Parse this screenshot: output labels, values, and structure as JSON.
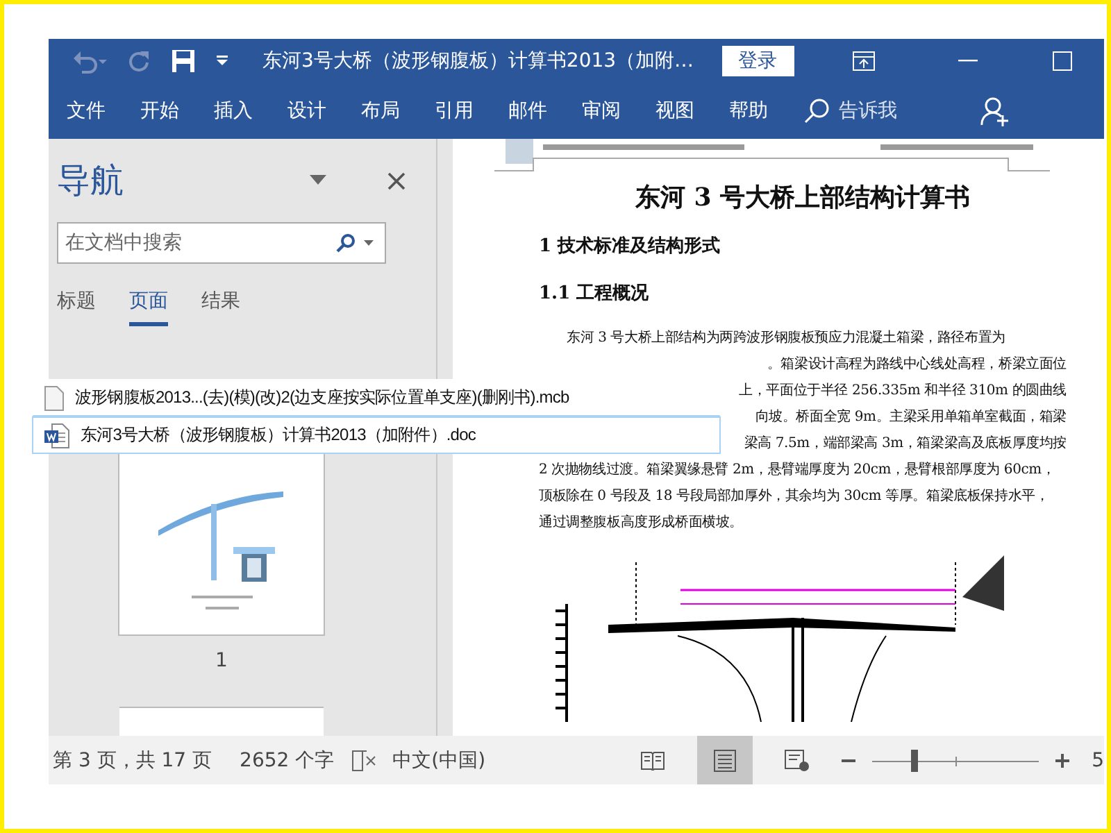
{
  "window": {
    "title": "东河3号大桥（波形钢腹板）计算书2013（加附…",
    "login": "登录"
  },
  "ribbon": {
    "tabs": [
      {
        "label": "文件"
      },
      {
        "label": "开始"
      },
      {
        "label": "插入"
      },
      {
        "label": "设计"
      },
      {
        "label": "布局"
      },
      {
        "label": "引用"
      },
      {
        "label": "邮件"
      },
      {
        "label": "审阅"
      },
      {
        "label": "视图"
      },
      {
        "label": "帮助"
      }
    ],
    "tell_me": "告诉我"
  },
  "navigation": {
    "title": "导航",
    "search": {
      "placeholder": "在文档中搜索"
    },
    "tabs": [
      {
        "label": "标题",
        "selected": false
      },
      {
        "label": "页面",
        "selected": true
      },
      {
        "label": "结果",
        "selected": false
      }
    ],
    "thumbnails": [
      {
        "label": "1"
      }
    ]
  },
  "document": {
    "blocks": [
      {
        "kind": "title",
        "text": "东河 3 号大桥上部结构计算书"
      },
      {
        "kind": "heading",
        "text": "1  技术标准及结构形式"
      },
      {
        "kind": "subheading",
        "text": "1.1 工程概况"
      },
      {
        "kind": "first-line",
        "text": "东河  3  号大桥上部结构为两跨波形钢腹板预应力混凝土箱梁，路径布置为"
      },
      {
        "kind": "partial",
        "text": "。箱梁设计高程为路线中心线处高程，桥梁立面位"
      },
      {
        "kind": "partial",
        "text": "上，平面位于半径 256.335m 和半径 310m 的圆曲线"
      },
      {
        "kind": "partial",
        "text": "向坡。桥面全宽 9m。主梁采用单箱单室截面，箱梁"
      },
      {
        "kind": "partial",
        "text": "梁高 7.5m，端部梁高 3m，箱梁梁高及底板厚度均按"
      },
      {
        "kind": "line",
        "text": "2 次抛物线过渡。箱梁翼缘悬臂 2m，悬臂端厚度为 20cm，悬臂根部厚度为 60cm，"
      },
      {
        "kind": "line",
        "text": "顶板除在 0 号段及 18 号段局部加厚外，其余均为 30cm 等厚。箱梁底板保持水平，"
      },
      {
        "kind": "line",
        "text": "通过调整腹板高度形成桥面横坡。"
      },
      {
        "kind": "figure"
      }
    ]
  },
  "files": [
    {
      "name": "波形钢腹板2013...(去)(模)(改)2(边支座按实际位置单支座)(删刚书).mcb",
      "kind": "blank",
      "selected": false
    },
    {
      "name": "东河3号大桥（波形钢腹板）计算书2013（加附件）.doc",
      "kind": "word",
      "selected": true
    }
  ],
  "status_bar": {
    "page": "第 3 页，共 17 页",
    "words": "2652 个字",
    "language": "中文(中国)",
    "views": [
      {
        "kind": "read",
        "selected": false
      },
      {
        "kind": "print",
        "selected": true
      },
      {
        "kind": "web",
        "selected": false
      }
    ],
    "zoom": {
      "level": 0.23,
      "value": "5"
    }
  }
}
